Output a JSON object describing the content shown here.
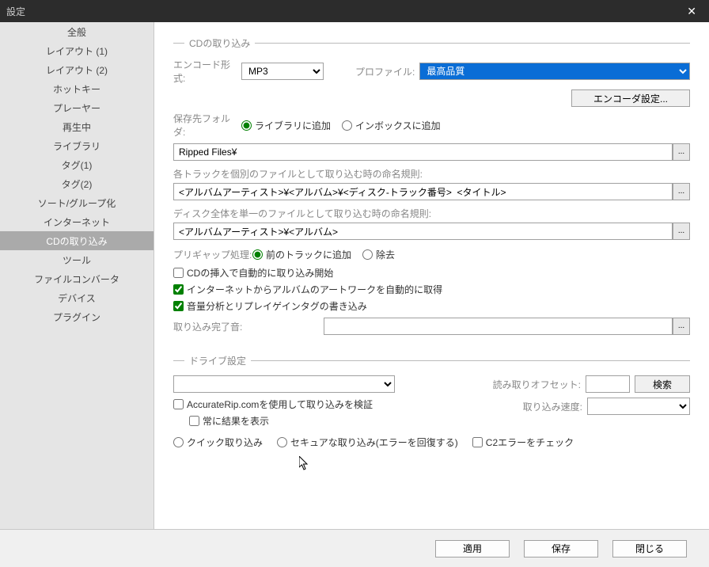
{
  "window": {
    "title": "設定"
  },
  "sidebar": {
    "items": [
      "全般",
      "レイアウト (1)",
      "レイアウト (2)",
      "ホットキー",
      "プレーヤー",
      "再生中",
      "ライブラリ",
      "タグ(1)",
      "タグ(2)",
      "ソート/グループ化",
      "インターネット",
      "CDの取り込み",
      "ツール",
      "ファイルコンバータ",
      "デバイス",
      "プラグイン"
    ],
    "active_index": 11
  },
  "sections": {
    "cd_rip": {
      "title": "CDの取り込み",
      "encode_label": "エンコード形式:",
      "encode_value": "MP3",
      "profile_label": "プロファイル:",
      "profile_value": "最高品質",
      "encoder_settings_btn": "エンコーダ設定...",
      "save_folder_label": "保存先フォルダ:",
      "save_radio_library": "ライブラリに追加",
      "save_radio_inbox": "インボックスに追加",
      "save_path": "Ripped Files¥",
      "per_track_caption": "各トラックを個別のファイルとして取り込む時の命名規則:",
      "per_track_pattern": "<アルバムアーティスト>¥<アルバム>¥<ディスク-トラック番号>  <タイトル>",
      "whole_disc_caption": "ディスク全体を単一のファイルとして取り込む時の命名規則:",
      "whole_disc_pattern": "<アルバムアーティスト>¥<アルバム>",
      "pregap_label": "プリギャップ処理:",
      "pregap_append": "前のトラックに追加",
      "pregap_remove": "除去",
      "cb_auto_rip": "CDの挿入で自動的に取り込み開始",
      "cb_artwork": "インターネットからアルバムのアートワークを自動的に取得",
      "cb_replaygain": "音量分析とリプレイゲインタグの書き込み",
      "complete_sound_label": "取り込み完了音:",
      "complete_sound_value": ""
    },
    "drive": {
      "title": "ドライブ設定",
      "drive_select_value": "",
      "read_offset_label": "読み取りオフセット:",
      "read_offset_value": "",
      "search_btn": "検索",
      "cb_accuraterip": "AccurateRip.comを使用して取り込みを検証",
      "cb_always_show": "常に結果を表示",
      "rip_speed_label": "取り込み速度:",
      "rip_speed_value": "",
      "radio_quick": "クイック取り込み",
      "radio_secure": "セキュアな取り込み(エラーを回復する)",
      "cb_c2": "C2エラーをチェック"
    }
  },
  "footer": {
    "apply": "適用",
    "save": "保存",
    "close": "閉じる"
  }
}
